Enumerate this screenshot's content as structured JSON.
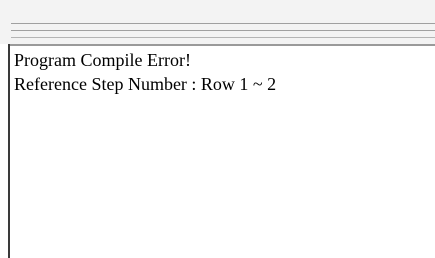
{
  "messages": [
    "Program Compile Error!",
    "Reference Step Number : Row 1 ~ 2"
  ]
}
